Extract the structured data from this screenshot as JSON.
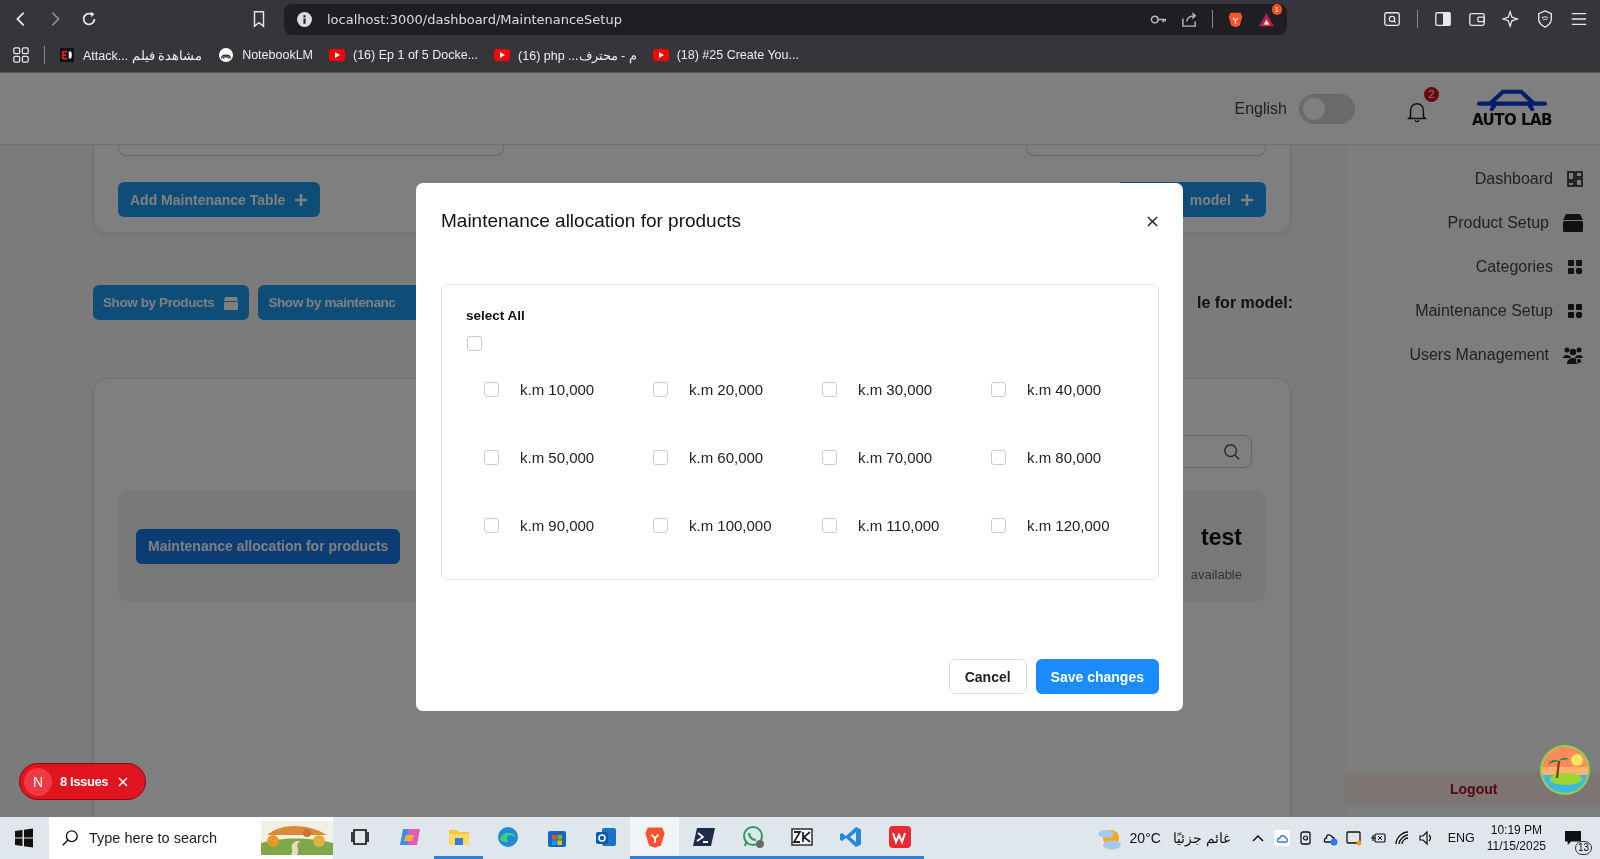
{
  "browser": {
    "url": "localhost:3000/dashboard/MaintenanceSetup",
    "extension_badge": "1",
    "bookmarks": [
      {
        "label": "Attack... مشاهدة فيلم",
        "kind": "ed"
      },
      {
        "label": "NotebookLM",
        "kind": "notebook"
      },
      {
        "label": "(16) Ep 1 of 5 Docke...",
        "kind": "youtube"
      },
      {
        "label": "(16) php ...م - محترف",
        "kind": "youtube"
      },
      {
        "label": "(18) #25 Create You...",
        "kind": "youtube"
      }
    ]
  },
  "header": {
    "language": "English",
    "language_toggle": {
      "on": false
    },
    "notification_count": "2",
    "logo": "AUTO LAB"
  },
  "sidebar": {
    "items": [
      {
        "label": "Dashboard",
        "kind": "dashboard"
      },
      {
        "label": "Product Setup",
        "kind": "box"
      },
      {
        "label": "Categories",
        "kind": "grid"
      },
      {
        "label": "Maintenance Setup",
        "kind": "grid"
      },
      {
        "label": "Users Management",
        "kind": "users"
      }
    ],
    "logout": "Logout"
  },
  "page": {
    "add_table_button": "Add Maintenance Table",
    "add_model_button": "model",
    "view_buttons": [
      {
        "label": "Show by Products",
        "kind": "box"
      },
      {
        "label": "Show by maintenanc",
        "kind": "plain"
      }
    ],
    "schedule_heading": "le for model:",
    "products": [
      {
        "button": "Maintenance allocation for products",
        "name": "test",
        "status": "available"
      }
    ]
  },
  "modal": {
    "title": "Maintenance allocation for products",
    "select_all": {
      "label": "select All",
      "checked": false
    },
    "options": [
      {
        "label": "k.m 10,000",
        "checked": false
      },
      {
        "label": "k.m 20,000",
        "checked": false
      },
      {
        "label": "k.m 30,000",
        "checked": false
      },
      {
        "label": "k.m 40,000",
        "checked": false
      },
      {
        "label": "k.m 50,000",
        "checked": false
      },
      {
        "label": "k.m 60,000",
        "checked": false
      },
      {
        "label": "k.m 70,000",
        "checked": false
      },
      {
        "label": "k.m 80,000",
        "checked": false
      },
      {
        "label": "k.m 90,000",
        "checked": false
      },
      {
        "label": "k.m 100,000",
        "checked": false
      },
      {
        "label": "k.m 110,000",
        "checked": false
      },
      {
        "label": "k.m 120,000",
        "checked": false
      }
    ],
    "cancel_button": "Cancel",
    "save_button": "Save changes"
  },
  "issues_badge": {
    "letter": "N",
    "label": "8 Issues"
  },
  "taskbar": {
    "search_placeholder": "Type here to search",
    "apps": [
      {
        "kind": "taskview",
        "running": false,
        "active": false
      },
      {
        "kind": "copilot",
        "running": false,
        "active": false
      },
      {
        "kind": "explorer",
        "running": true,
        "active": false
      },
      {
        "kind": "edge",
        "running": false,
        "active": false
      },
      {
        "kind": "store",
        "running": false,
        "active": false
      },
      {
        "kind": "outlook",
        "running": false,
        "active": false
      },
      {
        "kind": "brave",
        "running": true,
        "active": true
      },
      {
        "kind": "terminal",
        "running": true,
        "active": false
      },
      {
        "kind": "whatsapp",
        "running": true,
        "active": false
      },
      {
        "kind": "zk",
        "running": true,
        "active": false
      },
      {
        "kind": "vscode",
        "running": true,
        "active": false
      },
      {
        "kind": "wps",
        "running": true,
        "active": false
      }
    ],
    "temperature": "20°C",
    "weather": "غائم جزئيًا",
    "language": "ENG",
    "time": "10:19 PM",
    "date": "11/15/2025",
    "notification_count": "13"
  }
}
